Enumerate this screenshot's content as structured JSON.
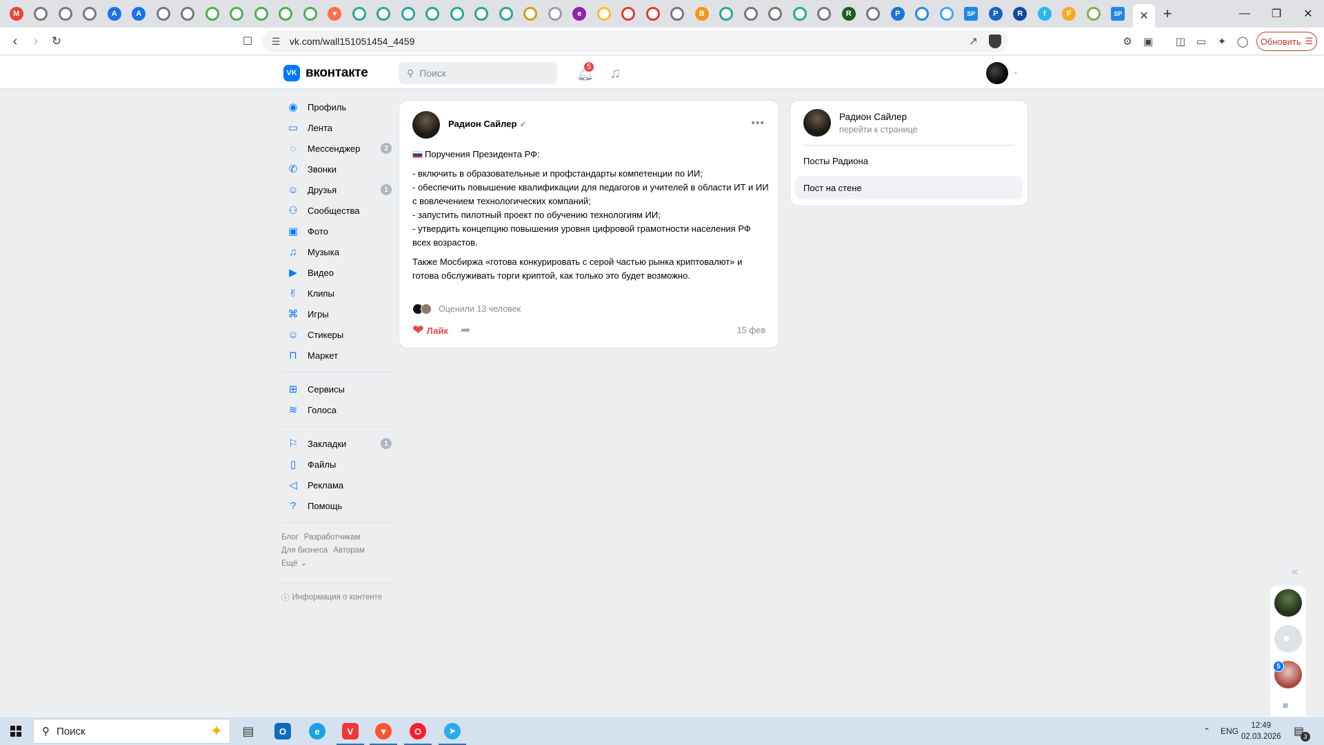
{
  "browser": {
    "tab_favicons": [
      {
        "icon": "gmail-icon",
        "color": "#ea4335",
        "glyph": "M"
      },
      {
        "icon": "site-icon",
        "color": "#777777",
        "glyph": ""
      },
      {
        "icon": "site-icon",
        "color": "#777777",
        "glyph": ""
      },
      {
        "icon": "site-icon",
        "color": "#777777",
        "glyph": ""
      },
      {
        "icon": "arrow-site-icon",
        "color": "#1a73e8",
        "glyph": "A"
      },
      {
        "icon": "arrow-site-icon",
        "color": "#1a73e8",
        "glyph": "A"
      },
      {
        "icon": "site-icon",
        "color": "#777777",
        "glyph": ""
      },
      {
        "icon": "site-icon",
        "color": "#777777",
        "glyph": ""
      },
      {
        "icon": "green-site-icon",
        "color": "#4caf50",
        "glyph": ""
      },
      {
        "icon": "green-site-icon",
        "color": "#4caf50",
        "glyph": ""
      },
      {
        "icon": "green-site-icon",
        "color": "#4caf50",
        "glyph": ""
      },
      {
        "icon": "green-site-icon",
        "color": "#4caf50",
        "glyph": ""
      },
      {
        "icon": "green-site-icon",
        "color": "#4caf50",
        "glyph": ""
      },
      {
        "icon": "heart-site-icon",
        "color": "#ff7043",
        "glyph": "♥"
      },
      {
        "icon": "colorful-site-icon",
        "color": "#26a69a",
        "glyph": ""
      },
      {
        "icon": "colorful-site-icon",
        "color": "#26a69a",
        "glyph": ""
      },
      {
        "icon": "colorful-site-icon",
        "color": "#26a69a",
        "glyph": ""
      },
      {
        "icon": "colorful-site-icon",
        "color": "#26a69a",
        "glyph": ""
      },
      {
        "icon": "colorful-site-icon",
        "color": "#26a69a",
        "glyph": ""
      },
      {
        "icon": "colorful-site-icon",
        "color": "#26a69a",
        "glyph": ""
      },
      {
        "icon": "colorful-site-icon",
        "color": "#26a69a",
        "glyph": ""
      },
      {
        "icon": "coin-site-icon",
        "color": "#d4a017",
        "glyph": ""
      },
      {
        "icon": "leaf-site-icon",
        "color": "#9e9e9e",
        "glyph": ""
      },
      {
        "icon": "purple-site-icon",
        "color": "#8e24aa",
        "glyph": "e"
      },
      {
        "icon": "yellow-site-icon",
        "color": "#fbc02d",
        "glyph": ""
      },
      {
        "icon": "pin-site-icon",
        "color": "#e53935",
        "glyph": ""
      },
      {
        "icon": "pin-site-icon",
        "color": "#e53935",
        "glyph": ""
      },
      {
        "icon": "site-icon",
        "color": "#777777",
        "glyph": ""
      },
      {
        "icon": "bitcoin-site-icon",
        "color": "#f7931a",
        "glyph": "B"
      },
      {
        "icon": "colorful-site-icon",
        "color": "#26a69a",
        "glyph": ""
      },
      {
        "icon": "site-icon",
        "color": "#777777",
        "glyph": ""
      },
      {
        "icon": "site-icon",
        "color": "#777777",
        "glyph": ""
      },
      {
        "icon": "colorful-site-icon",
        "color": "#26a69a",
        "glyph": ""
      },
      {
        "icon": "site-icon",
        "color": "#777777",
        "glyph": ""
      },
      {
        "icon": "dark-r-site-icon",
        "color": "#1b5e20",
        "glyph": "R"
      },
      {
        "icon": "site-icon",
        "color": "#777777",
        "glyph": ""
      },
      {
        "icon": "p-site-icon",
        "color": "#1976d2",
        "glyph": "P"
      },
      {
        "icon": "blue-site-icon",
        "color": "#1e88e5",
        "glyph": ""
      },
      {
        "icon": "blue-ring-site-icon",
        "color": "#42a5f5",
        "glyph": ""
      },
      {
        "icon": "sp-site-icon",
        "color": "#1e88e5",
        "glyph": "SP"
      },
      {
        "icon": "p-square-site-icon",
        "color": "#1565c0",
        "glyph": "P"
      },
      {
        "icon": "r-square-site-icon",
        "color": "#0d47a1",
        "glyph": "R"
      },
      {
        "icon": "f-site-icon",
        "color": "#29b6f6",
        "glyph": "f"
      },
      {
        "icon": "f-yellow-site-icon",
        "color": "#f9a825",
        "glyph": "F"
      },
      {
        "icon": "puzzle-site-icon",
        "color": "#7cb342",
        "glyph": ""
      },
      {
        "icon": "sp-site-icon",
        "color": "#1e88e5",
        "glyph": "SP"
      }
    ],
    "url": "vk.com/wall151051454_4459",
    "update_label": "Обновить"
  },
  "vk": {
    "logo_text": "вконтакте",
    "logo_mark": "VK",
    "search_placeholder": "Поиск",
    "notifications_count": "5"
  },
  "menu": {
    "group1": [
      {
        "name": "profile",
        "icon": "profile-icon",
        "glyph": "◉",
        "label": "Профиль",
        "count": ""
      },
      {
        "name": "feed",
        "icon": "feed-icon",
        "glyph": "▭",
        "label": "Лента",
        "count": ""
      },
      {
        "name": "messenger",
        "icon": "messenger-icon",
        "glyph": "◌",
        "label": "Мессенджер",
        "count": "2"
      },
      {
        "name": "calls",
        "icon": "phone-icon",
        "glyph": "✆",
        "label": "Звонки",
        "count": ""
      },
      {
        "name": "friends",
        "icon": "friends-icon",
        "glyph": "☺",
        "label": "Друзья",
        "count": "1"
      },
      {
        "name": "communities",
        "icon": "communities-icon",
        "glyph": "⚇",
        "label": "Сообщества",
        "count": ""
      },
      {
        "name": "photo",
        "icon": "photo-icon",
        "glyph": "▣",
        "label": "Фото",
        "count": ""
      },
      {
        "name": "music",
        "icon": "music-icon",
        "glyph": "♫",
        "label": "Музыка",
        "count": ""
      },
      {
        "name": "video",
        "icon": "video-icon",
        "glyph": "▶",
        "label": "Видео",
        "count": ""
      },
      {
        "name": "clips",
        "icon": "clips-icon",
        "glyph": "✌",
        "label": "Клипы",
        "count": ""
      },
      {
        "name": "games",
        "icon": "gamepad-icon",
        "glyph": "⌘",
        "label": "Игры",
        "count": ""
      },
      {
        "name": "stickers",
        "icon": "sticker-icon",
        "glyph": "☺",
        "label": "Стикеры",
        "count": ""
      },
      {
        "name": "market",
        "icon": "bag-icon",
        "glyph": "⊓",
        "label": "Маркет",
        "count": ""
      }
    ],
    "group2": [
      {
        "name": "services",
        "icon": "grid-icon",
        "glyph": "⊞",
        "label": "Сервисы",
        "count": ""
      },
      {
        "name": "votes",
        "icon": "coins-icon",
        "glyph": "≋",
        "label": "Голоса",
        "count": ""
      }
    ],
    "group3": [
      {
        "name": "bookmarks",
        "icon": "bookmark-icon",
        "glyph": "⚐",
        "label": "Закладки",
        "count": "1"
      },
      {
        "name": "files",
        "icon": "file-icon",
        "glyph": "▯",
        "label": "Файлы",
        "count": ""
      },
      {
        "name": "ads",
        "icon": "megaphone-icon",
        "glyph": "◁",
        "label": "Реклама",
        "count": ""
      },
      {
        "name": "help",
        "icon": "help-icon",
        "glyph": "?",
        "label": "Помощь",
        "count": ""
      }
    ],
    "footer": {
      "blog": "Блог",
      "developers": "Разработчикам",
      "business": "Для бизнеса",
      "authors": "Авторам",
      "more": "Ещё",
      "content_info": "Информация о контенте"
    }
  },
  "post": {
    "author": "Радион Сайлер",
    "title": "Поручения Президента РФ:",
    "lines": [
      "- включить в образовательные и профстандарты компетенции по ИИ;",
      "- обеспечить повышение квалификации для педагогов и учителей в области ИТ и ИИ с вовлечением технологических компаний;",
      "- запустить пилотный проект по обучению технологиям ИИ;",
      "- утвердить концепцию повышения уровня цифровой грамотности населения РФ всех возрастов."
    ],
    "paragraph2": "Также Мосбиржа «готова конкурировать с серой частью рынка криптовалют» и готова обслуживать торги криптой, как только это будет возможно.",
    "rated_text": "Оценили 13 человек",
    "like_label": "Лайк",
    "date": "15 фев"
  },
  "right_card": {
    "name": "Радион Сайлер",
    "link": "перейти к странице",
    "items": [
      "Посты Радиона",
      "Пост на стене"
    ]
  },
  "chat": {
    "badge": "5"
  },
  "taskbar": {
    "search_placeholder": "Поиск",
    "apps": [
      {
        "name": "task-view",
        "icon": "task-view-icon",
        "color": "#3a3a3a",
        "glyph": "▤"
      },
      {
        "name": "outlook",
        "icon": "outlook-icon",
        "color": "#0f6cbd",
        "glyph": "O"
      },
      {
        "name": "edge",
        "icon": "edge-icon",
        "color": "#1ba1e2",
        "glyph": "e"
      },
      {
        "name": "vivaldi",
        "icon": "vivaldi-icon",
        "color": "#ef3939",
        "glyph": "V"
      },
      {
        "name": "brave",
        "icon": "brave-icon",
        "color": "#fb542b",
        "glyph": "▼"
      },
      {
        "name": "opera",
        "icon": "opera-icon",
        "color": "#ff1b2d",
        "glyph": "O"
      },
      {
        "name": "telegram",
        "icon": "telegram-icon",
        "color": "#2aabee",
        "glyph": "➤"
      }
    ],
    "lang": "ENG",
    "time": "12:49",
    "date": "02.03.2026",
    "notifications": "3"
  }
}
